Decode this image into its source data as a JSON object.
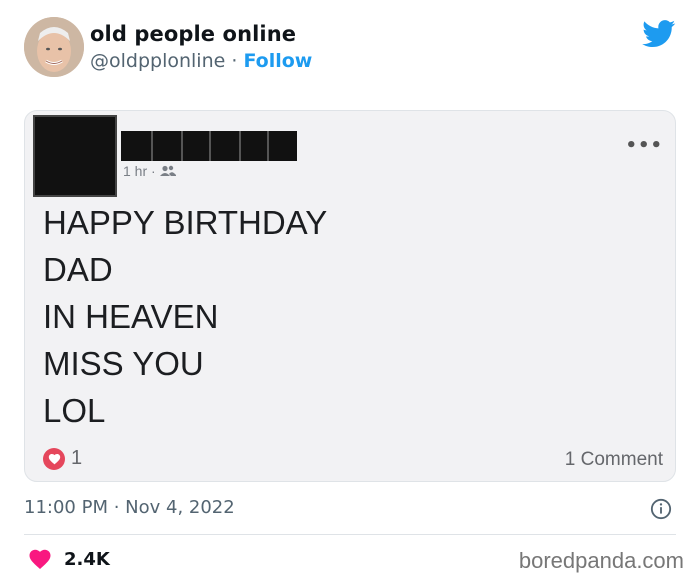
{
  "author": {
    "name": "old people online",
    "handle": "@oldpplonline",
    "separator": " · ",
    "follow_label": "Follow"
  },
  "embedded_post": {
    "time": "1 hr",
    "meta_separator": " · ",
    "lines": [
      "HAPPY BIRTHDAY",
      "DAD",
      "IN HEAVEN",
      "MISS YOU",
      "LOL"
    ],
    "reaction_count": "1",
    "comment_count": "1 Comment",
    "more_icon": "•••"
  },
  "tweet": {
    "timestamp": "11:00 PM · Nov 4, 2022",
    "likes": "2.4K"
  },
  "watermark": "boredpanda.com",
  "colors": {
    "accent": "#1d9bf0",
    "like_heart": "#f91880",
    "reaction_love": "#e5475c"
  }
}
